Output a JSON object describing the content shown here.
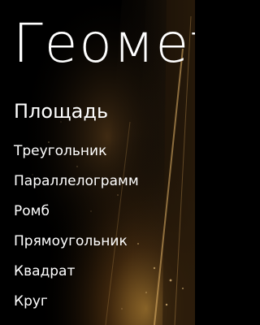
{
  "app": {
    "title": "Геометрия"
  },
  "page": {
    "section_title": "Площадь"
  },
  "menu": {
    "items": [
      {
        "label": "Треугольник"
      },
      {
        "label": "Параллелограмм"
      },
      {
        "label": "Ромб"
      },
      {
        "label": "Прямоугольник"
      },
      {
        "label": "Квадрат"
      },
      {
        "label": "Круг"
      }
    ]
  },
  "colors": {
    "background": "#000000",
    "text": "#ffffff",
    "accent_gold": "#c8923a"
  }
}
